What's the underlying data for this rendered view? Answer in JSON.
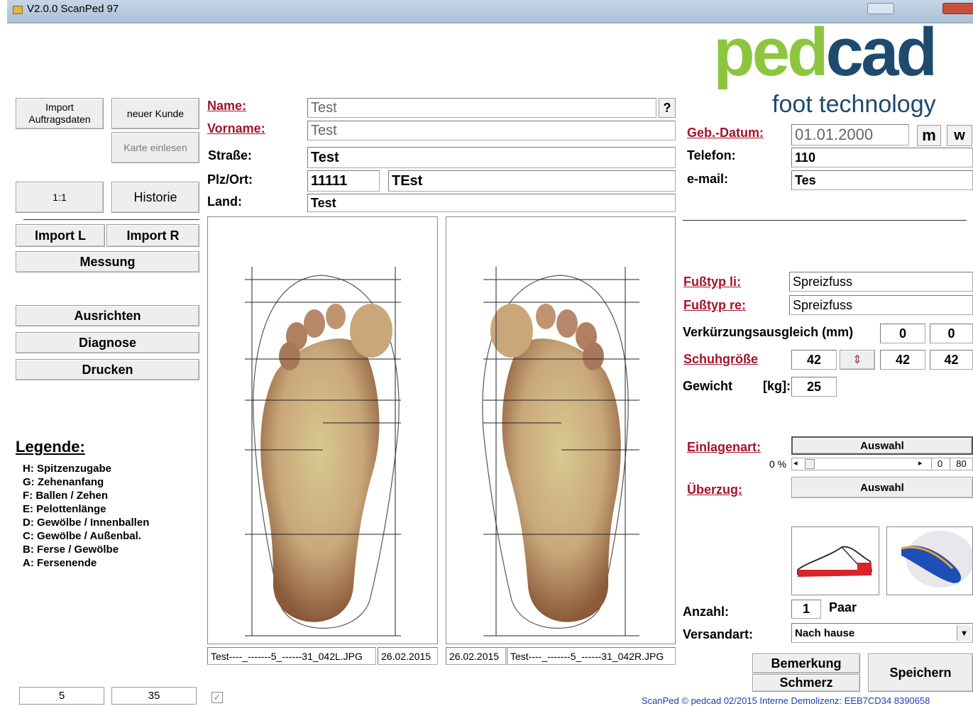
{
  "window": {
    "title": "V2.0.0 ScanPed 97"
  },
  "logo": {
    "brand": "pedcad",
    "tagline": "foot technology"
  },
  "left_buttons": {
    "import_order": "Import\nAuftragsdaten",
    "new_customer": "neuer Kunde",
    "read_card": "Karte einlesen",
    "one_to_one": "1:1",
    "history": "Historie",
    "import_l": "Import L",
    "import_r": "Import R",
    "measure": "Messung",
    "align": "Ausrichten",
    "diagnosis": "Diagnose",
    "print": "Drucken"
  },
  "legend": {
    "title": "Legende:",
    "items": [
      "H: Spitzenzugabe",
      "G: Zehenanfang",
      "F: Ballen / Zehen",
      "E: Pelottenlänge",
      "D: Gewölbe / Innenballen",
      "C: Gewölbe / Außenbal.",
      "B: Ferse / Gewölbe",
      "A: Fersenende"
    ]
  },
  "customer": {
    "name_label": "Name:",
    "name": "Test",
    "help": "?",
    "firstname_label": "Vorname:",
    "firstname": "Test",
    "street_label": "Straße:",
    "street": "Test",
    "zip_label": "Plz/Ort:",
    "zip": "11111",
    "city": "TEst",
    "country_label": "Land:",
    "country": "Test"
  },
  "contact": {
    "birth_label": "Geb.-Datum:",
    "birth": "01.01.2000",
    "m": "m",
    "w": "w",
    "phone_label": "Telefon:",
    "phone": "110",
    "email_label": "e-mail:",
    "email": "Tes"
  },
  "scans": {
    "left_file": "Test----_-------5_------31_042L.JPG",
    "left_date": "26.02.2015",
    "right_date": "26.02.2015",
    "right_file": "Test----_-------5_------31_042R.JPG"
  },
  "foot": {
    "type_left_label": "Fußtyp li:",
    "type_left": "Spreizfuss",
    "type_right_label": "Fußtyp re:",
    "type_right": "Spreizfuss",
    "shortening_label": "Verkürzungsausgleich (mm)",
    "shortening_l": "0",
    "shortening_r": "0",
    "shoe_size_label": "Schuhgröße",
    "shoe_size": "42",
    "shoe_size_l": "42",
    "shoe_size_r": "42",
    "weight_label": "Gewicht",
    "weight_unit": "[kg]:",
    "weight": "25"
  },
  "insole": {
    "type_label": "Einlagenart:",
    "type_button": "Auswahl",
    "percent": "0 %",
    "scroll_min": "0",
    "scroll_max": "80",
    "cover_label": "Überzug:",
    "cover_button": "Auswahl"
  },
  "order": {
    "count_label": "Anzahl:",
    "count": "1",
    "count_unit": "Paar",
    "shipping_label": "Versandart:",
    "shipping": "Nach hause",
    "remark": "Bemerkung",
    "pain": "Schmerz",
    "save": "Speichern"
  },
  "status": {
    "left": "5",
    "right": "35",
    "checkbox": "✓"
  },
  "footer": "ScanPed © pedcad 02/2015  Interne Demolizenz: EEB7CD34 8390658"
}
